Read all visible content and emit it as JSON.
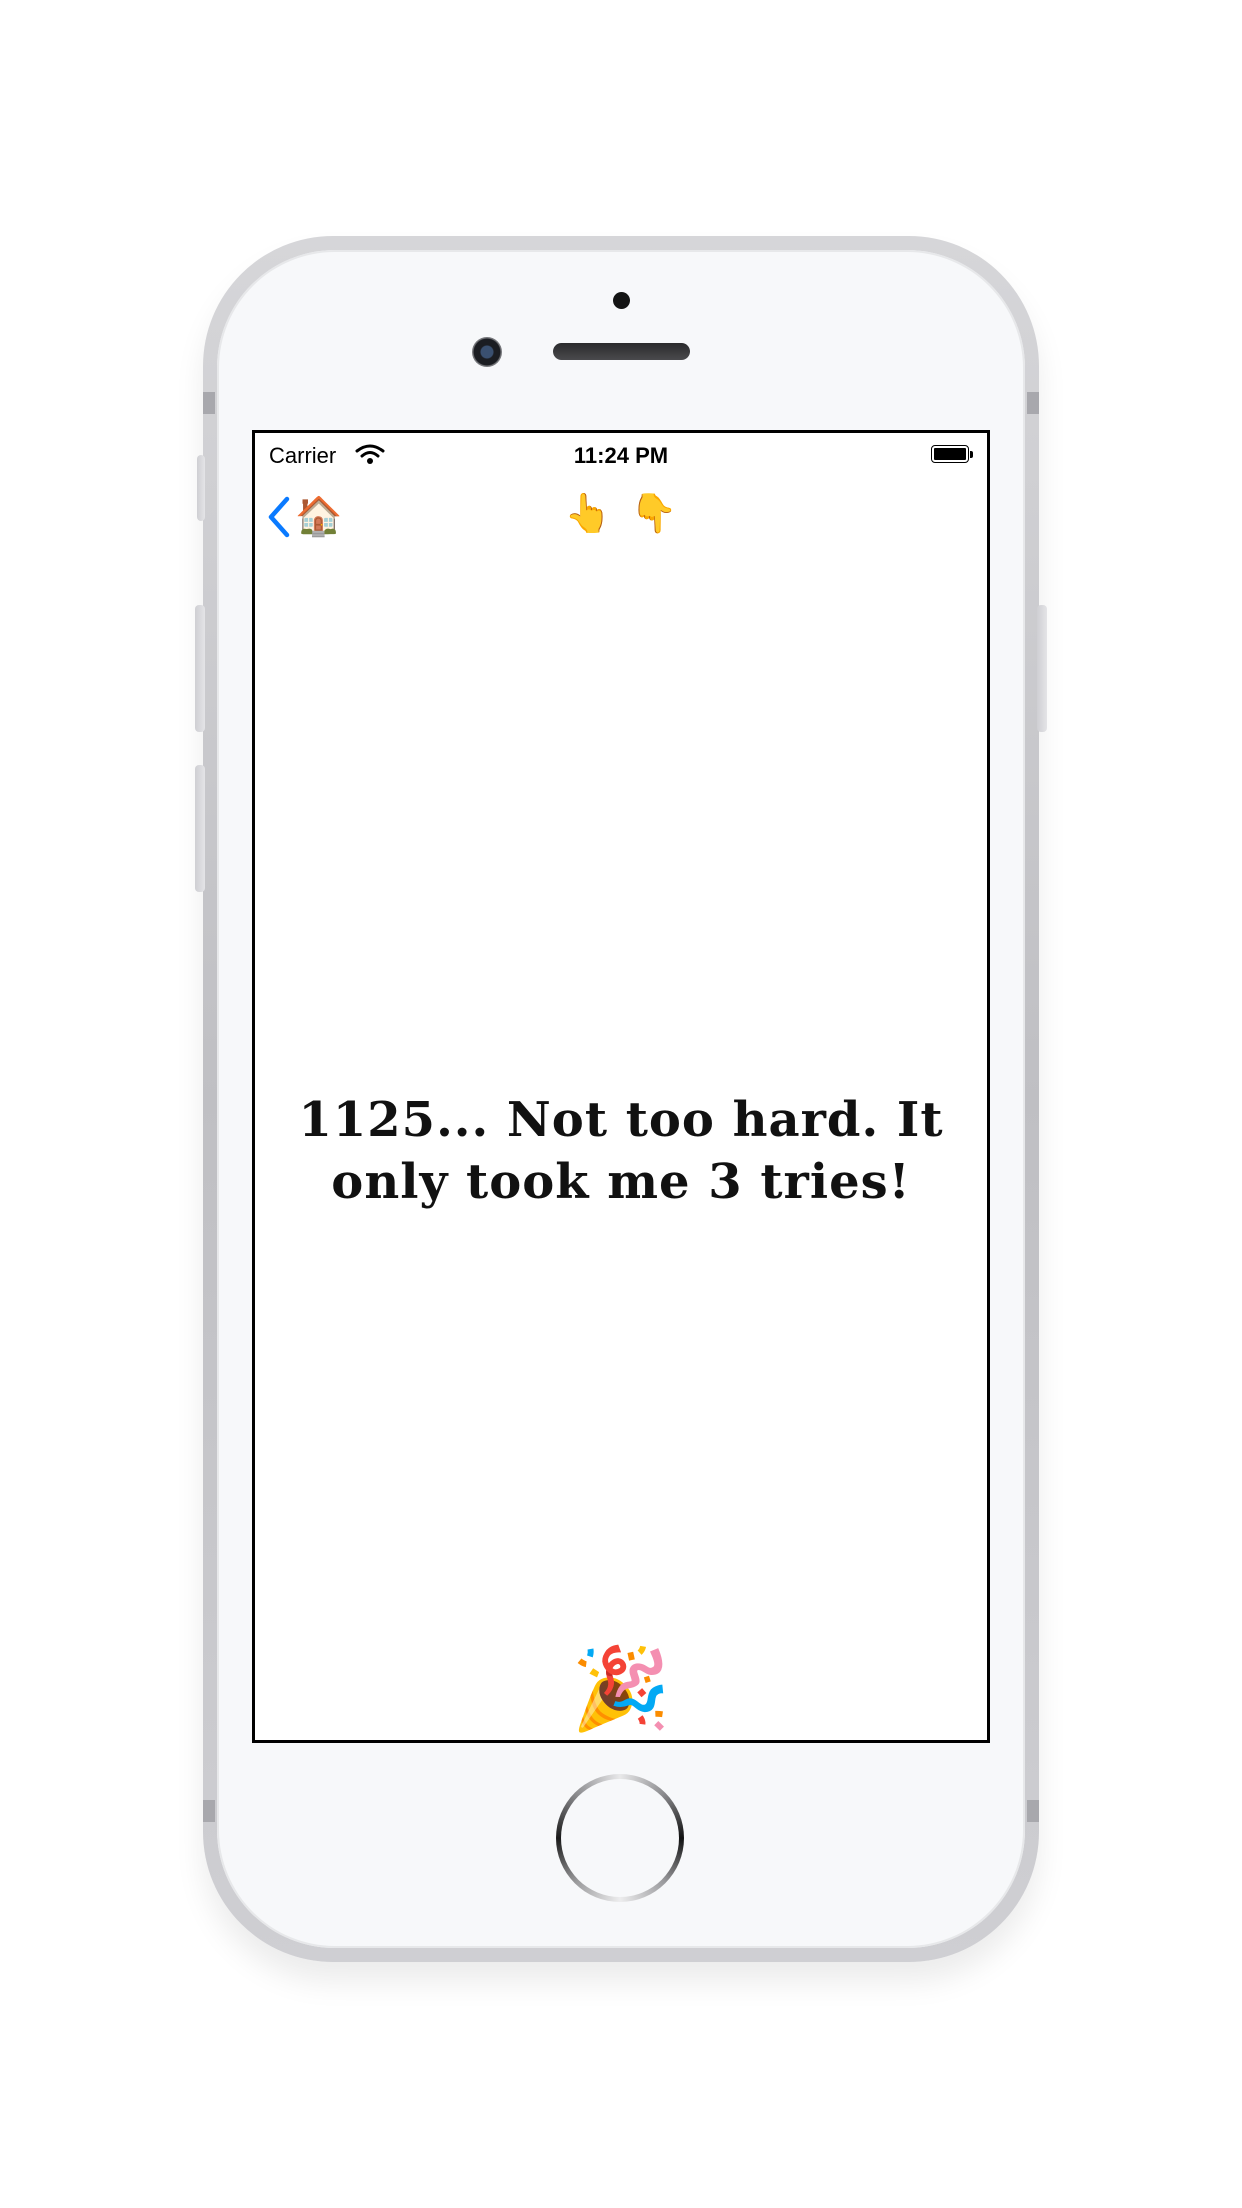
{
  "status_bar": {
    "carrier": "Carrier",
    "time": "11:24 PM"
  },
  "nav": {
    "back_emoji": "🏠",
    "title_up": "👆",
    "title_down": "👇"
  },
  "content": {
    "message": "1125... Not too hard. It only took me 3 tries!",
    "celebration_emoji": "🎉"
  },
  "colors": {
    "accent": "#0a7aff",
    "text": "#111111",
    "screen_border": "#000000"
  },
  "icons": [
    "wifi-icon",
    "battery-icon",
    "back-chevron-icon"
  ]
}
